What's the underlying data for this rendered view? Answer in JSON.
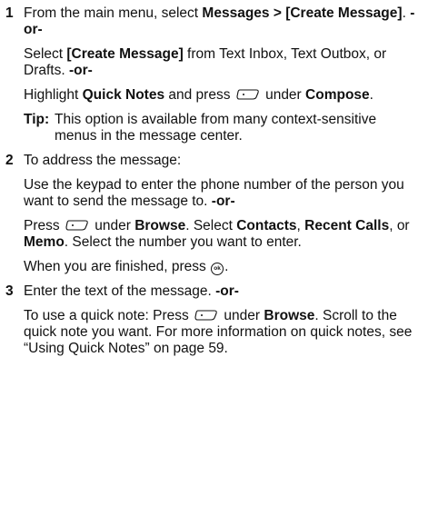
{
  "steps": [
    {
      "number": "1",
      "p1": {
        "t1": "From the main menu, select ",
        "b1": "Messages > [Create Message]",
        "t2": ". ",
        "or": "-or-"
      },
      "p2": {
        "b1": "[Create Message]",
        "t1": " from Text Inbox, Text Outbox, or Drafts. ",
        "pre": "Select ",
        "or": "-or-"
      },
      "p3": {
        "t1": "Highlight ",
        "b1": "Quick Notes",
        "t2": " and press ",
        "t3": " under ",
        "b2": "Compose",
        "t4": "."
      },
      "tip": {
        "label": "Tip:",
        "text": "This option is available from many context-sensitive menus in the message center."
      }
    },
    {
      "number": "2",
      "p1": {
        "t1": "To address the message:"
      },
      "p2": {
        "t1": "Use the keypad to enter the phone number of the person you want to send the message to. ",
        "or": "-or-"
      },
      "p3": {
        "t1": "Press ",
        "t2": " under ",
        "b1": "Browse",
        "t3": ". Select ",
        "b2": "Contacts",
        "t4": ", ",
        "b3": "Recent Calls",
        "t5": ", or ",
        "b4": "Memo",
        "t6": ". Select the number you want to enter."
      },
      "p4": {
        "t1": "When you are finished, press ",
        "ok": "ok",
        "t2": "."
      }
    },
    {
      "number": "3",
      "p1": {
        "t1": "Enter the text of the message. ",
        "or": "-or-"
      },
      "p2": {
        "t1": "To use a quick note: Press ",
        "t2": " under ",
        "b1": "Browse",
        "t3": ". Scroll to the quick note you want. For more information on quick notes, see “Using Quick Notes” on page 59."
      }
    }
  ],
  "icons": {
    "softkey": "left-softkey-icon",
    "ok": "ok-key-icon"
  }
}
